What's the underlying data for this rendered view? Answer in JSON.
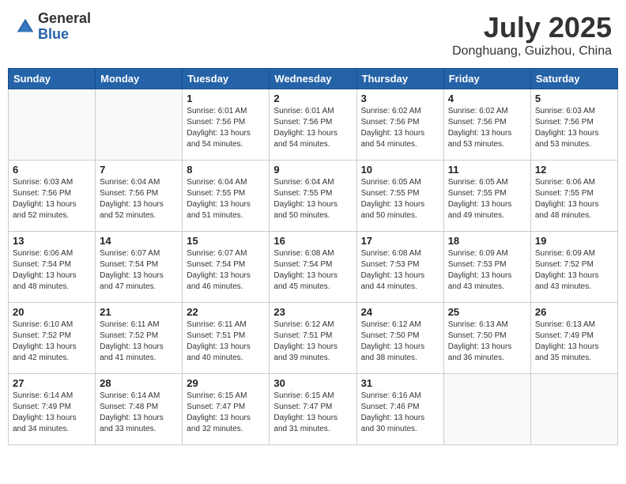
{
  "logo": {
    "general": "General",
    "blue": "Blue"
  },
  "header": {
    "month": "July 2025",
    "location": "Donghuang, Guizhou, China"
  },
  "weekdays": [
    "Sunday",
    "Monday",
    "Tuesday",
    "Wednesday",
    "Thursday",
    "Friday",
    "Saturday"
  ],
  "weeks": [
    [
      {
        "day": "",
        "info": ""
      },
      {
        "day": "",
        "info": ""
      },
      {
        "day": "1",
        "sunrise": "Sunrise: 6:01 AM",
        "sunset": "Sunset: 7:56 PM",
        "daylight": "Daylight: 13 hours and 54 minutes."
      },
      {
        "day": "2",
        "sunrise": "Sunrise: 6:01 AM",
        "sunset": "Sunset: 7:56 PM",
        "daylight": "Daylight: 13 hours and 54 minutes."
      },
      {
        "day": "3",
        "sunrise": "Sunrise: 6:02 AM",
        "sunset": "Sunset: 7:56 PM",
        "daylight": "Daylight: 13 hours and 54 minutes."
      },
      {
        "day": "4",
        "sunrise": "Sunrise: 6:02 AM",
        "sunset": "Sunset: 7:56 PM",
        "daylight": "Daylight: 13 hours and 53 minutes."
      },
      {
        "day": "5",
        "sunrise": "Sunrise: 6:03 AM",
        "sunset": "Sunset: 7:56 PM",
        "daylight": "Daylight: 13 hours and 53 minutes."
      }
    ],
    [
      {
        "day": "6",
        "sunrise": "Sunrise: 6:03 AM",
        "sunset": "Sunset: 7:56 PM",
        "daylight": "Daylight: 13 hours and 52 minutes."
      },
      {
        "day": "7",
        "sunrise": "Sunrise: 6:04 AM",
        "sunset": "Sunset: 7:56 PM",
        "daylight": "Daylight: 13 hours and 52 minutes."
      },
      {
        "day": "8",
        "sunrise": "Sunrise: 6:04 AM",
        "sunset": "Sunset: 7:55 PM",
        "daylight": "Daylight: 13 hours and 51 minutes."
      },
      {
        "day": "9",
        "sunrise": "Sunrise: 6:04 AM",
        "sunset": "Sunset: 7:55 PM",
        "daylight": "Daylight: 13 hours and 50 minutes."
      },
      {
        "day": "10",
        "sunrise": "Sunrise: 6:05 AM",
        "sunset": "Sunset: 7:55 PM",
        "daylight": "Daylight: 13 hours and 50 minutes."
      },
      {
        "day": "11",
        "sunrise": "Sunrise: 6:05 AM",
        "sunset": "Sunset: 7:55 PM",
        "daylight": "Daylight: 13 hours and 49 minutes."
      },
      {
        "day": "12",
        "sunrise": "Sunrise: 6:06 AM",
        "sunset": "Sunset: 7:55 PM",
        "daylight": "Daylight: 13 hours and 48 minutes."
      }
    ],
    [
      {
        "day": "13",
        "sunrise": "Sunrise: 6:06 AM",
        "sunset": "Sunset: 7:54 PM",
        "daylight": "Daylight: 13 hours and 48 minutes."
      },
      {
        "day": "14",
        "sunrise": "Sunrise: 6:07 AM",
        "sunset": "Sunset: 7:54 PM",
        "daylight": "Daylight: 13 hours and 47 minutes."
      },
      {
        "day": "15",
        "sunrise": "Sunrise: 6:07 AM",
        "sunset": "Sunset: 7:54 PM",
        "daylight": "Daylight: 13 hours and 46 minutes."
      },
      {
        "day": "16",
        "sunrise": "Sunrise: 6:08 AM",
        "sunset": "Sunset: 7:54 PM",
        "daylight": "Daylight: 13 hours and 45 minutes."
      },
      {
        "day": "17",
        "sunrise": "Sunrise: 6:08 AM",
        "sunset": "Sunset: 7:53 PM",
        "daylight": "Daylight: 13 hours and 44 minutes."
      },
      {
        "day": "18",
        "sunrise": "Sunrise: 6:09 AM",
        "sunset": "Sunset: 7:53 PM",
        "daylight": "Daylight: 13 hours and 43 minutes."
      },
      {
        "day": "19",
        "sunrise": "Sunrise: 6:09 AM",
        "sunset": "Sunset: 7:52 PM",
        "daylight": "Daylight: 13 hours and 43 minutes."
      }
    ],
    [
      {
        "day": "20",
        "sunrise": "Sunrise: 6:10 AM",
        "sunset": "Sunset: 7:52 PM",
        "daylight": "Daylight: 13 hours and 42 minutes."
      },
      {
        "day": "21",
        "sunrise": "Sunrise: 6:11 AM",
        "sunset": "Sunset: 7:52 PM",
        "daylight": "Daylight: 13 hours and 41 minutes."
      },
      {
        "day": "22",
        "sunrise": "Sunrise: 6:11 AM",
        "sunset": "Sunset: 7:51 PM",
        "daylight": "Daylight: 13 hours and 40 minutes."
      },
      {
        "day": "23",
        "sunrise": "Sunrise: 6:12 AM",
        "sunset": "Sunset: 7:51 PM",
        "daylight": "Daylight: 13 hours and 39 minutes."
      },
      {
        "day": "24",
        "sunrise": "Sunrise: 6:12 AM",
        "sunset": "Sunset: 7:50 PM",
        "daylight": "Daylight: 13 hours and 38 minutes."
      },
      {
        "day": "25",
        "sunrise": "Sunrise: 6:13 AM",
        "sunset": "Sunset: 7:50 PM",
        "daylight": "Daylight: 13 hours and 36 minutes."
      },
      {
        "day": "26",
        "sunrise": "Sunrise: 6:13 AM",
        "sunset": "Sunset: 7:49 PM",
        "daylight": "Daylight: 13 hours and 35 minutes."
      }
    ],
    [
      {
        "day": "27",
        "sunrise": "Sunrise: 6:14 AM",
        "sunset": "Sunset: 7:49 PM",
        "daylight": "Daylight: 13 hours and 34 minutes."
      },
      {
        "day": "28",
        "sunrise": "Sunrise: 6:14 AM",
        "sunset": "Sunset: 7:48 PM",
        "daylight": "Daylight: 13 hours and 33 minutes."
      },
      {
        "day": "29",
        "sunrise": "Sunrise: 6:15 AM",
        "sunset": "Sunset: 7:47 PM",
        "daylight": "Daylight: 13 hours and 32 minutes."
      },
      {
        "day": "30",
        "sunrise": "Sunrise: 6:15 AM",
        "sunset": "Sunset: 7:47 PM",
        "daylight": "Daylight: 13 hours and 31 minutes."
      },
      {
        "day": "31",
        "sunrise": "Sunrise: 6:16 AM",
        "sunset": "Sunset: 7:46 PM",
        "daylight": "Daylight: 13 hours and 30 minutes."
      },
      {
        "day": "",
        "info": ""
      },
      {
        "day": "",
        "info": ""
      }
    ]
  ]
}
